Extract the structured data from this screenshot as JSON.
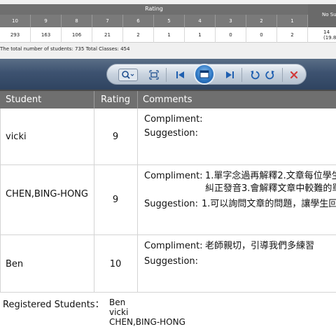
{
  "summary": {
    "rating_title": "Rating",
    "no_submit_header": "No Su",
    "rating_columns": [
      "10",
      "9",
      "8",
      "7",
      "6",
      "5",
      "4",
      "3",
      "2",
      "1"
    ],
    "counts": [
      "293",
      "163",
      "106",
      "21",
      "2",
      "1",
      "1",
      "0",
      "0",
      "2"
    ],
    "no_submit_value_line1": "14",
    "no_submit_value_line2": "(19.8",
    "total_line": "The total number of students: 735   Total Classes: 454"
  },
  "toolbar": {
    "icons": [
      "zoom-icon",
      "fit-page-icon",
      "first-page-icon",
      "page-view-icon",
      "last-page-icon",
      "rotate-left-icon",
      "rotate-right-icon",
      "close-icon"
    ]
  },
  "table": {
    "headers": {
      "student": "Student",
      "rating": "Rating",
      "comments": "Comments"
    },
    "rows": [
      {
        "student": "vicki",
        "rating": "9",
        "compliment_label": "Compliment:",
        "compliment_line1": "",
        "compliment_line2": "",
        "suggestion_label": "Suggestion:",
        "suggestion_text": ""
      },
      {
        "student": "CHEN,BING-HONG",
        "rating": "9",
        "compliment_label": "Compliment:",
        "compliment_line1": "1.單字念過再解釋2.文章每位學生",
        "compliment_line2": "糾正發音3.會解釋文章中較難的單",
        "suggestion_label": "Suggestion:",
        "suggestion_text": "1.可以詢問文章的問題，讓學生回"
      },
      {
        "student": "Ben",
        "rating": "10",
        "compliment_label": "Compliment:",
        "compliment_line1": "老師親切，引導我們多練習",
        "compliment_line2": "",
        "suggestion_label": "Suggestion:",
        "suggestion_text": ""
      }
    ]
  },
  "registered": {
    "label": "Registered Students：",
    "names": [
      "Ben",
      "vicki",
      "CHEN,BING-HONG"
    ]
  },
  "colors": {
    "header_gray": "#6f6f6f",
    "toolbar_blue": "#3d5270",
    "toolbar_red": "#d23a3a"
  }
}
